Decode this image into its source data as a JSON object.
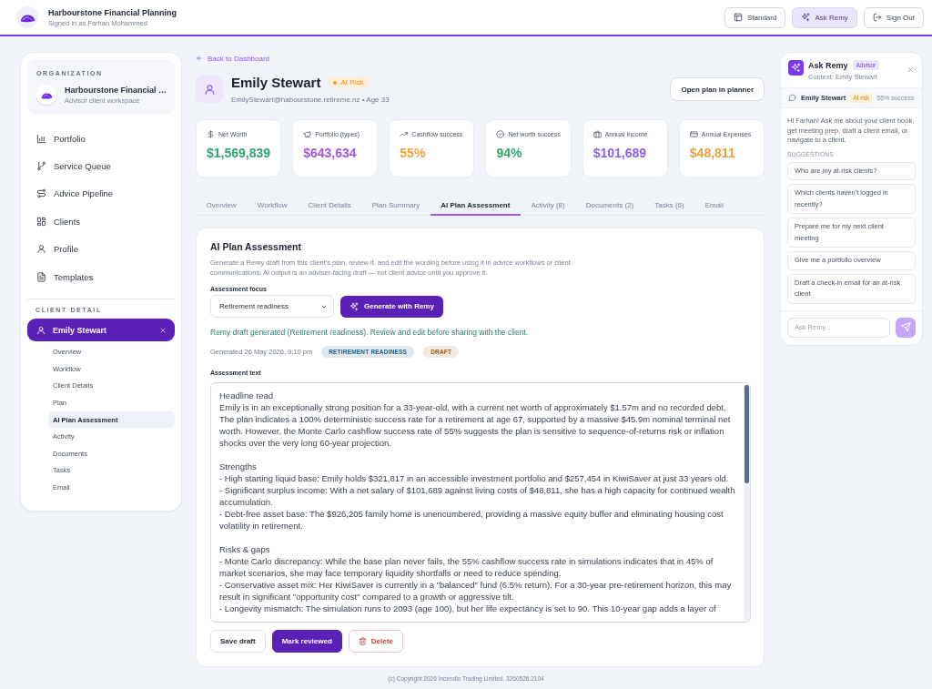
{
  "header": {
    "title": "Harbourstone Financial Planning",
    "subtitle": "Signed in as Farhan Mohammed",
    "buttons": [
      {
        "label": "Standard",
        "selected": false
      },
      {
        "label": "Ask Remy",
        "selected": true
      },
      {
        "label": "Sign Out",
        "selected": false
      }
    ]
  },
  "sidebar": {
    "organization": {
      "label": "ORGANIZATION",
      "name": "Harbourstone Financial …",
      "subtitle": "Advisor client workspace"
    },
    "nav": [
      "Portfolio",
      "Service Queue",
      "Advice Pipeline",
      "Clients",
      "Profile",
      "Templates"
    ],
    "client_section": {
      "label": "CLIENT DETAIL",
      "client": "Emily Stewart",
      "items": [
        {
          "label": "Overview",
          "selected": false
        },
        {
          "label": "Workflow",
          "selected": false
        },
        {
          "label": "Client Details",
          "selected": false
        },
        {
          "label": "Plan",
          "selected": false
        },
        {
          "label": "AI Plan Assessment",
          "selected": true
        },
        {
          "label": "Activity",
          "selected": false
        },
        {
          "label": "Documents",
          "selected": false
        },
        {
          "label": "Tasks",
          "selected": false
        },
        {
          "label": "Email",
          "selected": false
        }
      ]
    }
  },
  "client": {
    "back_link": "Back to Dashboard",
    "name": "Emily Stewart",
    "status": "At Risk",
    "details": "EmilyStewart@habourstone.retireme.nz • Age 33",
    "open_button": "Open plan in planner"
  },
  "stats": [
    {
      "label": "Net Worth",
      "value": "$1,569,839",
      "color": "#2ea36f"
    },
    {
      "label": "Portfolio (types)",
      "value": "$643,634",
      "color": "#a552e6"
    },
    {
      "label": "Cashflow success",
      "value": "55%",
      "color": "#f0a13a"
    },
    {
      "label": "Net worth success",
      "value": "94%",
      "color": "#2ea36f"
    },
    {
      "label": "Annual Income",
      "value": "$101,689",
      "color": "#8b5cf6"
    },
    {
      "label": "Annual Expenses",
      "value": "$48,811",
      "color": "#f0a13a"
    }
  ],
  "tabs": [
    {
      "label": "Overview",
      "selected": false
    },
    {
      "label": "Workflow",
      "selected": false
    },
    {
      "label": "Client Details",
      "selected": false
    },
    {
      "label": "Plan Summary",
      "selected": false
    },
    {
      "label": "AI Plan Assessment",
      "selected": true
    },
    {
      "label": "Activity (8)",
      "selected": false
    },
    {
      "label": "Documents (2)",
      "selected": false
    },
    {
      "label": "Tasks (6)",
      "selected": false
    },
    {
      "label": "Email",
      "selected": false
    }
  ],
  "assessment": {
    "title": "AI Plan Assessment",
    "description": "Generate a Remy draft from this client's plan, review it, and edit the wording before using it in advice workflows or client communications. AI output is an adviser-facing draft — not client advice until you approve it.",
    "focus_label": "Assessment focus",
    "focus_value": "Retirement readiness",
    "generate_button": "Generate with Remy",
    "message": "Remy draft generated (Retirement readiness). Review and edit before sharing with the client.",
    "generated": "Generated 26 May 2026, 9:10 pm",
    "tags": [
      {
        "label": "RETIREMENT READINESS",
        "color": "#1d5f8c"
      },
      {
        "label": "DRAFT",
        "color": "#9a5b12"
      }
    ],
    "text_label": "Assessment text",
    "text": "Headline read\nEmily is in an exceptionally strong position for a 33-year-old, with a current net worth of approximately $1.57m and no recorded debt. The plan indicates a 100% deterministic success rate for a retirement at age 67, supported by a massive $45.9m nominal terminal net worth. However, the Monte Carlo cashflow success rate of 55% suggests the plan is sensitive to sequence-of-returns risk or inflation shocks over the very long 60-year projection.\n\nStrengths\n- High starting liquid base: Emily holds $321,817 in an accessible investment portfolio and $257,454 in KiwiSaver at just 33 years old.\n- Significant surplus income: With a net salary of $101,689 against living costs of $48,811, she has a high capacity for continued wealth accumulation.\n- Debt-free asset base: The $926,205 family home is unencumbered, providing a massive equity buffer and eliminating housing cost volatility in retirement.\n\nRisks & gaps\n- Monte Carlo discrepancy: While the base plan never fails, the 55% cashflow success rate in simulations indicates that in 45% of market scenarios, she may face temporary liquidity shortfalls or need to reduce spending.\n- Conservative asset mix: Her KiwiSaver is currently in a \"balanced\" fund (6.5% return). For a 30-year pre-retirement horizon, this may result in significant \"opportunity cost\" compared to a growth or aggressive tilt.\n- Longevity mismatch: The simulation runs to 2093 (age 100), but her life expectancy is set to 90. This 10-year gap adds a layer of",
    "buttons": [
      {
        "label": "Save draft",
        "kind": "secondary"
      },
      {
        "label": "Mark reviewed",
        "kind": "primary"
      },
      {
        "label": "Delete",
        "kind": "danger"
      }
    ]
  },
  "assistant": {
    "title": "Ask Remy",
    "badge": "Advisor",
    "context": "Context: Emily Stewart",
    "client": "Emily Stewart",
    "status": "At risk",
    "success": "55% success",
    "greeting": "Hi Farhan! Ask me about your client book, get meeting prep, draft a client email, or navigate to a client.",
    "suggestions_label": "SUGGESTIONS",
    "suggestions": [
      "Who are my at-risk clients?",
      "Which clients haven't logged in recently?",
      "Prepare me for my next client meeting",
      "Give me a portfolio overview",
      "Draft a check-in email for an at-risk client"
    ],
    "input": {
      "placeholder": "Ask Remy..."
    }
  },
  "footer": "(c) Copyright 2026 Incendio Trading Limited. 3260526.2104"
}
